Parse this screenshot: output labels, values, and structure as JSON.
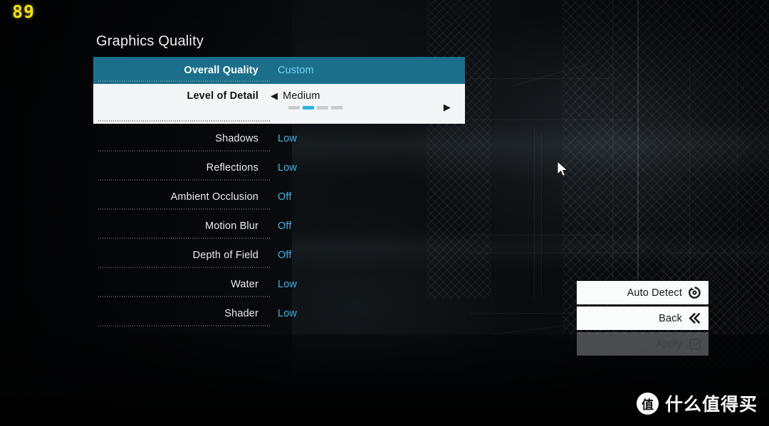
{
  "hud": {
    "counter": "89"
  },
  "panel": {
    "title": "Graphics Quality",
    "rows": [
      {
        "label": "Overall Quality",
        "value": "Custom",
        "state": "teal"
      },
      {
        "label": "Level of Detail",
        "value": "Medium",
        "state": "white",
        "arrow_left": "◀",
        "arrow_right": "▶",
        "segments": 4,
        "segment_active": 2
      },
      {
        "label": "Shadows",
        "value": "Low",
        "state": "normal"
      },
      {
        "label": "Reflections",
        "value": "Low",
        "state": "normal"
      },
      {
        "label": "Ambient Occlusion",
        "value": "Off",
        "state": "normal"
      },
      {
        "label": "Motion Blur",
        "value": "Off",
        "state": "normal"
      },
      {
        "label": "Depth of Field",
        "value": "Off",
        "state": "normal"
      },
      {
        "label": "Water",
        "value": "Low",
        "state": "normal"
      },
      {
        "label": "Shader",
        "value": "Low",
        "state": "normal"
      }
    ]
  },
  "actions": [
    {
      "label": "Auto Detect",
      "icon": "rotate-button-icon",
      "enabled": true
    },
    {
      "label": "Back",
      "icon": "double-chevron-left-icon",
      "enabled": true
    },
    {
      "label": "Apply",
      "icon": "enter-key-icon",
      "enabled": false
    }
  ],
  "watermark": {
    "logo_char": "值",
    "text": "什么值得买"
  },
  "colors": {
    "accent_teal": "#1c6f8b",
    "value_blue": "#3fb5e8",
    "segment_active": "#29b5e8",
    "hud_yellow": "#f2e30c",
    "panel_white": "#f4f5f6"
  }
}
